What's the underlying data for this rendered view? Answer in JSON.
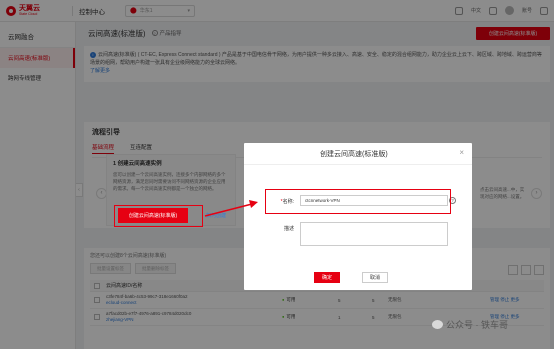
{
  "brand": {
    "name": "天翼云",
    "sub": "State Cloud"
  },
  "topbar": {
    "console": "控制中心",
    "region": "华东1",
    "lang": "中文",
    "user": "账号"
  },
  "sidebar": {
    "title": "云网融合",
    "items": [
      {
        "label": "云间高速(标准版)"
      },
      {
        "label": "跨网专线管理"
      }
    ]
  },
  "page": {
    "title": "云间高速(标准版)",
    "help": "产品指导",
    "create_button": "创建云间高速(标准版)"
  },
  "info": {
    "line1": "云间高速(标准版) ( CT-EC, Express Connect standard ) 产品是基于中国电信骨干网络，为用户提供一种多云接入、高速、安全、稳定的混合组网能力，助力企业云上云下、跨区域、跨地域、跨运营商等",
    "line2": "场景的组网，帮助用户构建一张具有企业级网络能力的全球云网络。",
    "link": "了解更多"
  },
  "guide": {
    "title": "流程引导",
    "tabs": [
      {
        "label": "基础流程"
      },
      {
        "label": "互连配置"
      }
    ],
    "step_title": "1  创建云间高速实例",
    "step_desc": "您可以创建一个云间高速实例，连接多个内部网络的多个网络资源，满足您同时需要访问不同网络资源的企业应用的需求。每一个云间高速实例都是一个独立的网络。",
    "step_button": "创建云间高速(标准版)",
    "step_link": "如何创建",
    "right_text": "点击云间高速...中，实现对应的网络...设置。"
  },
  "list": {
    "summary": "您还可以创建8个云间高速(标准版)",
    "btn1": "批量设置标签",
    "btn2": "批量删除标签",
    "col_id": "云间高速ID/名称",
    "rows": [
      {
        "id": "c3fe784f-ba6b-4c53-99c7-318e1660f0a2",
        "name": "ecloud-connect",
        "status": "可用",
        "v1": "5",
        "v2": "5",
        "policy": "无限包",
        "ops": "管理  停止  更多"
      },
      {
        "id": "a7facd02b-e7f7-4976-a891-c9784d020dc0",
        "name": "zhejiang-VPN",
        "status": "可用",
        "v1": "1",
        "v2": "5",
        "policy": "无限包",
        "ops": "管理  停止  更多"
      }
    ]
  },
  "modal": {
    "title": "创建云间高速(标准版)",
    "name_label": "名称:",
    "name_req": "*",
    "name_value": "ctcnnetwork-VPN",
    "desc_label": "描述",
    "ok": "确定",
    "cancel": "取消"
  },
  "watermark": {
    "text": "公众号 · 铁车哥"
  },
  "colors": {
    "primary": "#e60012",
    "link": "#2e7bdb",
    "success": "#52c41a"
  }
}
